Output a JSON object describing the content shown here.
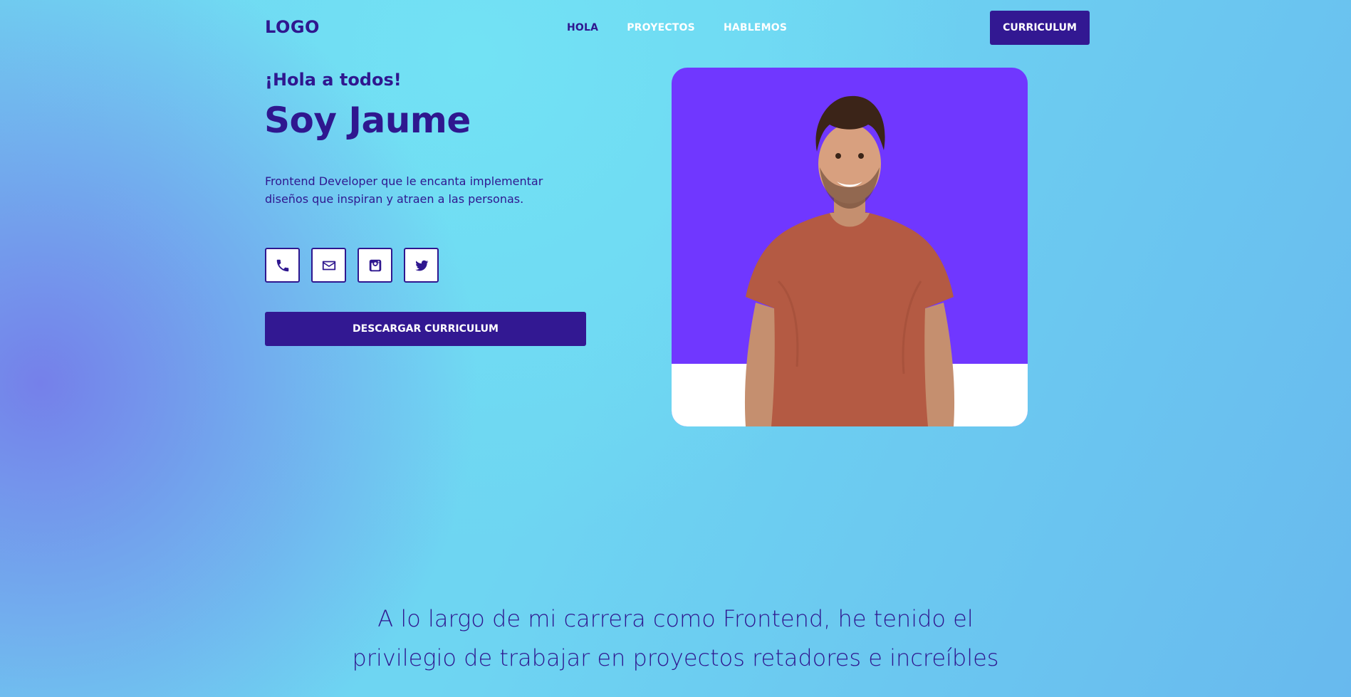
{
  "header": {
    "logo": "LOGO",
    "nav": [
      {
        "label": "HOLA",
        "active": true
      },
      {
        "label": "PROYECTOS",
        "active": false
      },
      {
        "label": "HABLEMOS",
        "active": false
      }
    ],
    "cv_button": "CURRICULUM"
  },
  "hero": {
    "greeting": "¡Hola a todos!",
    "name": "Soy Jaume",
    "description": "Frontend Developer que le encanta implementar diseños que inspiran y atraen a las personas.",
    "socials": [
      {
        "icon": "phone-icon"
      },
      {
        "icon": "mail-icon"
      },
      {
        "icon": "instagram-icon"
      },
      {
        "icon": "twitter-icon"
      }
    ],
    "download_button": "DESCARGAR CURRICULUM"
  },
  "career": {
    "line1": "A lo largo de mi carrera como Frontend, he tenido el",
    "line2": "privilegio de trabajar en proyectos retadores e increíbles"
  },
  "colors": {
    "primary": "#321892",
    "photo_background": "#7037ff",
    "text": "#2f178f"
  }
}
